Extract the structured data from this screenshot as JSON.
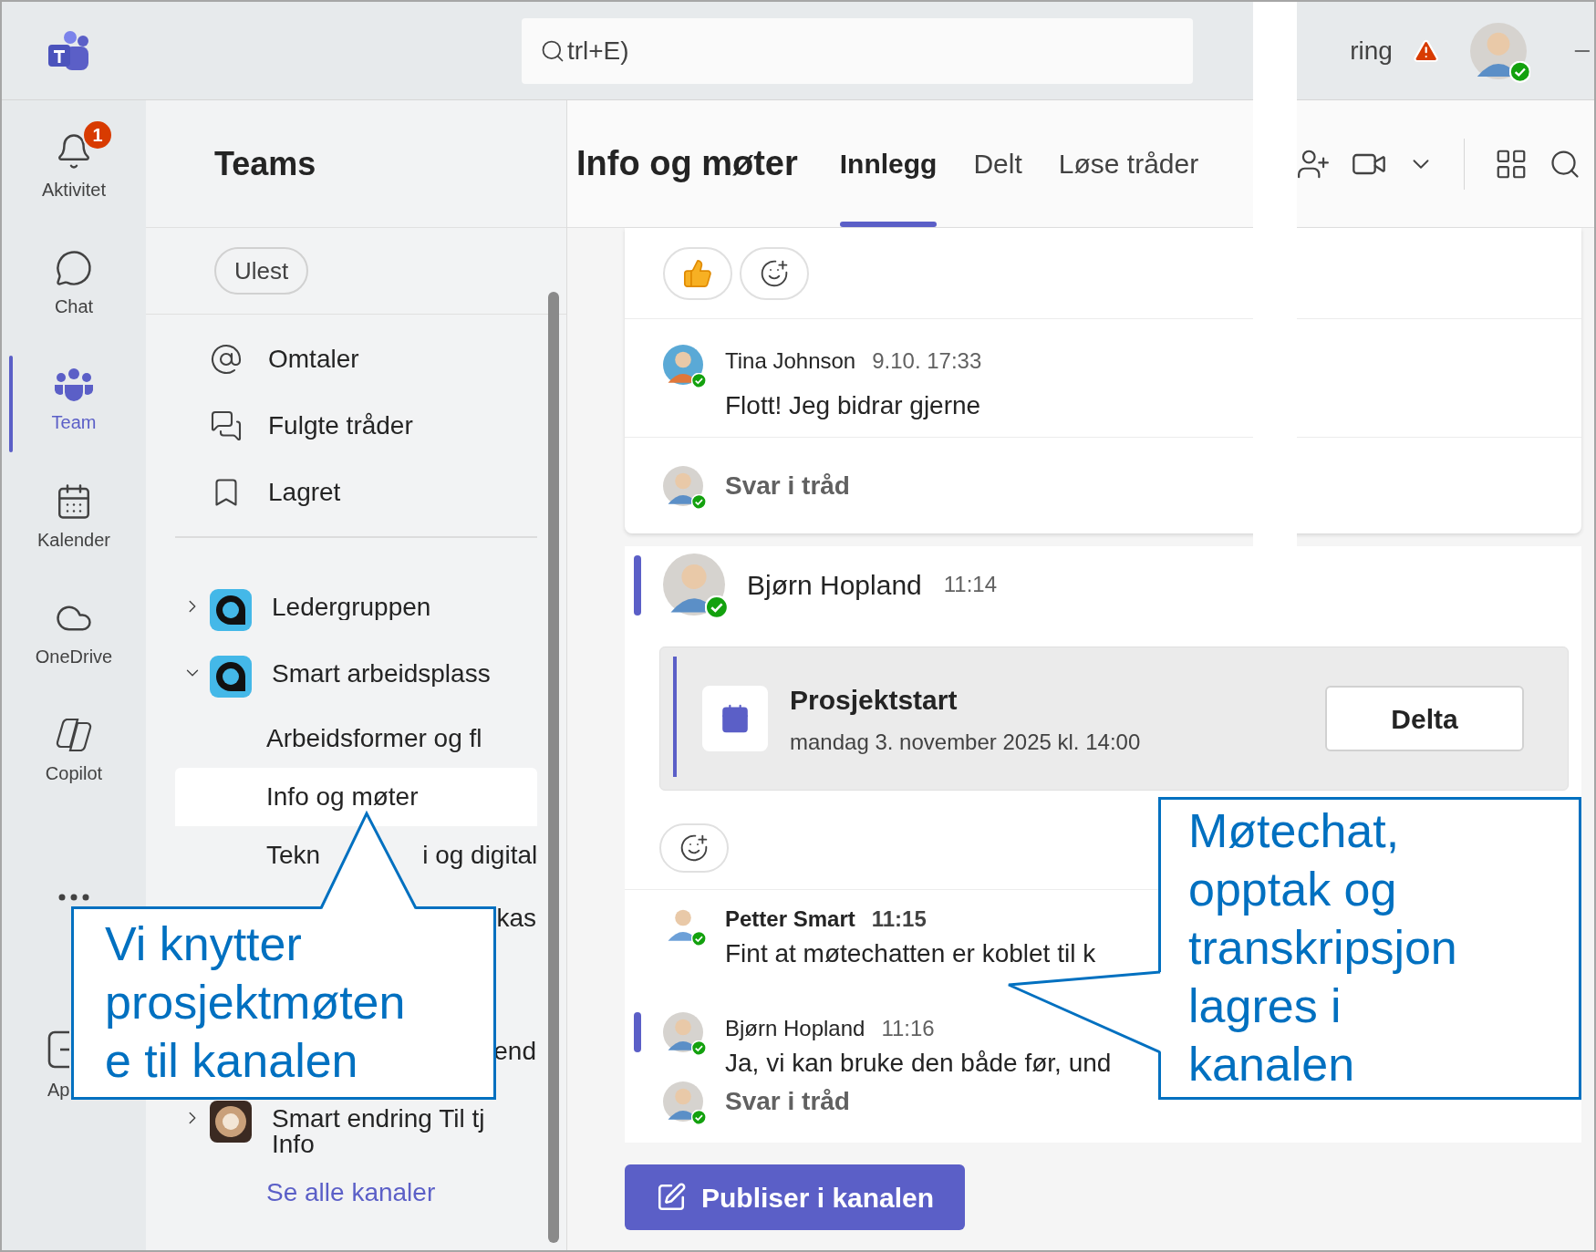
{
  "titlebar": {
    "search": {
      "value": "trl+E)"
    },
    "org_fragment": "ring",
    "warning": true
  },
  "rail": [
    {
      "label": "Aktivitet",
      "kind": "bell",
      "badge": "1",
      "selected": false
    },
    {
      "label": "Chat",
      "kind": "chat",
      "selected": false
    },
    {
      "label": "Team",
      "kind": "teams",
      "selected": true
    },
    {
      "label": "Kalender",
      "kind": "calendar",
      "selected": false
    },
    {
      "label": "OneDrive",
      "kind": "cloud",
      "selected": false
    },
    {
      "label": "Copilot",
      "kind": "copilot",
      "selected": false
    },
    {
      "kind": "more"
    },
    {
      "label": "Ap",
      "kind": "apps",
      "selected": false
    }
  ],
  "teams_panel": {
    "title": "Teams",
    "filter": "Ulest",
    "quick_links": [
      {
        "label": "Omtaler",
        "kind": "mention"
      },
      {
        "label": "Fulgte tråder",
        "kind": "followed"
      },
      {
        "label": "Lagret",
        "kind": "saved"
      }
    ],
    "list": [
      {
        "kind": "team",
        "name": "Ledergruppen",
        "expanded": false
      },
      {
        "kind": "team",
        "name": "Smart arbeidsplass",
        "expanded": true
      },
      {
        "kind": "channel",
        "parts": [
          "Arbeidsformer og fl"
        ],
        "selected": false
      },
      {
        "kind": "channel",
        "parts": [
          "Info og møter"
        ],
        "selected": true
      },
      {
        "kind": "channel",
        "parts": [
          "Tekn",
          "i og digital"
        ],
        "selected": false
      },
      {
        "kind": "fragment",
        "text": "kas"
      },
      {
        "kind": "gap"
      },
      {
        "kind": "fragment",
        "text": "end"
      },
      {
        "kind": "team",
        "name": "Smart endring Til tj",
        "subtitle": "Info",
        "expanded": false
      }
    ],
    "see_all": "Se alle kanaler"
  },
  "channel": {
    "title": "Info og møter",
    "tabs": [
      {
        "label": "Innlegg",
        "selected": true
      },
      {
        "label": "Delt",
        "selected": false
      },
      {
        "label": "Løse tråder",
        "selected": false
      }
    ]
  },
  "thread": {
    "reactions": [
      {
        "kind": "like"
      },
      {
        "kind": "add"
      }
    ],
    "reply": {
      "author": "Tina Johnson",
      "time": "9.10. 17:33",
      "text": "Flott! Jeg bidrar gjerne"
    },
    "reply_prompt": "Svar i tråd"
  },
  "post": {
    "author": "Bjørn Hopland",
    "time": "11:14",
    "meeting": {
      "title": "Prosjektstart",
      "when": "mandag 3. november 2025 kl. 14:00",
      "button": "Delta"
    },
    "replies": [
      {
        "author": "Petter Smart",
        "time": "11:15",
        "text": "Fint at møtechatten er koblet til k",
        "bold": true,
        "marked": false
      },
      {
        "author": "Bjørn Hopland",
        "time": "11:16",
        "text": "Ja, vi kan bruke den både før, und",
        "bold": false,
        "marked": true
      }
    ],
    "reply_prompt": "Svar i tråd"
  },
  "compose": {
    "button": "Publiser i kanalen"
  },
  "callouts": [
    {
      "kind": "left",
      "text": "Vi knytter\nprosjektmøten\ne til kanalen"
    },
    {
      "kind": "right",
      "text": "Møtechat,\nopptak og\ntranskripsjon\nlagres i\nkanalen"
    }
  ]
}
